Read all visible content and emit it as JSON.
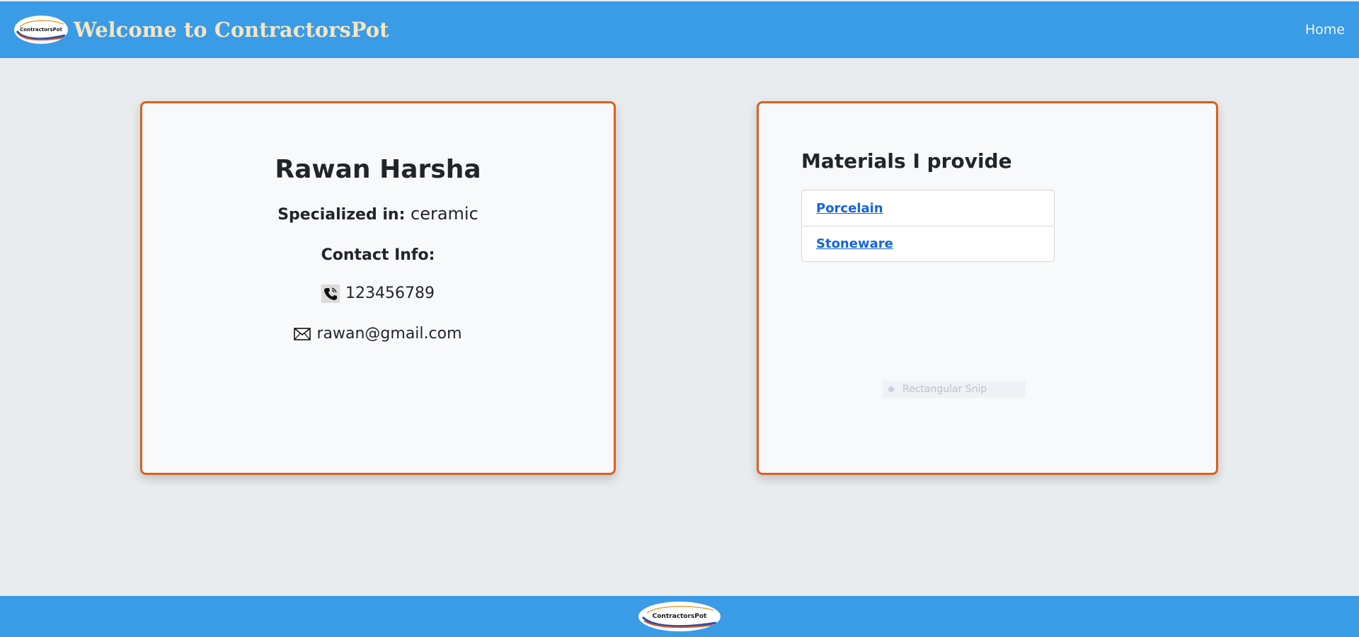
{
  "header": {
    "logo_text": "ContractorsPot",
    "title": "Welcome to ContractorsPot",
    "nav": {
      "home_label": "Home"
    }
  },
  "profile": {
    "name": "Rawan Harsha",
    "specialized_label": "Specialized in:",
    "specialized_value": "ceramic",
    "contact_heading": "Contact Info:",
    "phone": "123456789",
    "email": "rawan@gmail.com",
    "phone_icon": "phone-icon",
    "email_icon": "mail-icon"
  },
  "materials": {
    "title": "Materials I provide",
    "items": [
      {
        "label": "Porcelain"
      },
      {
        "label": "Stoneware"
      }
    ]
  },
  "overlay": {
    "snip_label": "Rectangular Snip"
  },
  "footer": {
    "logo_text": "ContractorsPot"
  },
  "colors": {
    "navbar": "#3a9be6",
    "brand_title": "#f5e6c2",
    "card_border": "#d8621e",
    "link": "#1565d8",
    "page_bg": "#e9ecef",
    "card_bg": "#f8f9fa"
  }
}
